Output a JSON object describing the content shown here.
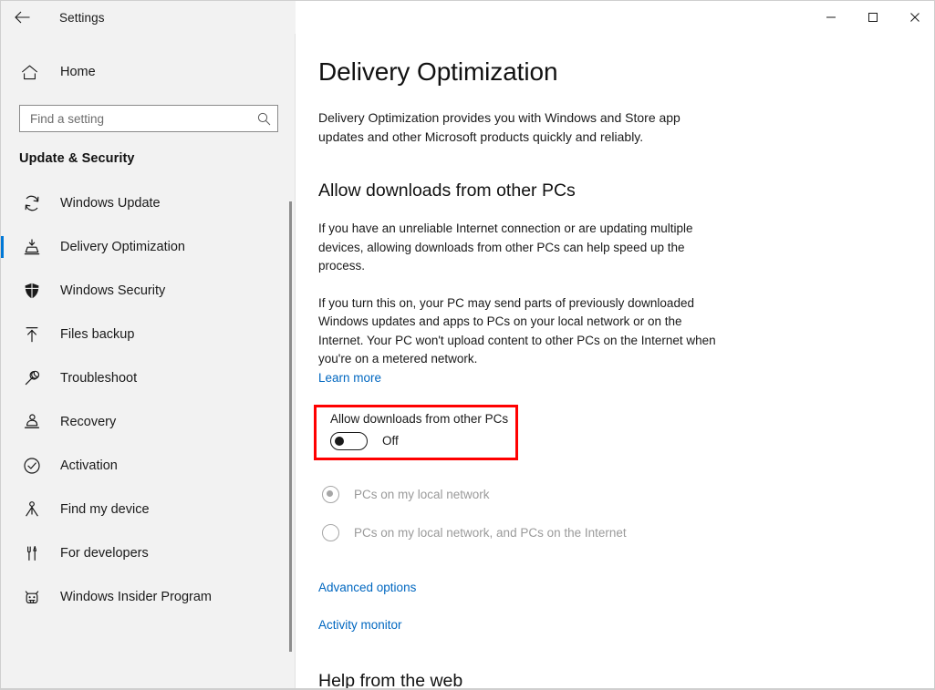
{
  "window": {
    "titlebar": {
      "back_icon": "back-arrow-icon",
      "title": "Settings",
      "minimize_label": "Minimize",
      "maximize_label": "Maximize",
      "close_label": "Close"
    },
    "accent_color": "#0078d7",
    "highlight_color": "#ff0000",
    "link_color": "#0067c0"
  },
  "sidebar": {
    "home": {
      "icon": "home-icon",
      "label": "Home"
    },
    "search": {
      "icon": "search-icon",
      "placeholder": "Find a setting",
      "value": ""
    },
    "category": "Update & Security",
    "items": [
      {
        "icon": "sync-refresh-icon",
        "label": "Windows Update",
        "selected": false
      },
      {
        "icon": "delivery-box-icon",
        "label": "Delivery Optimization",
        "selected": true
      },
      {
        "icon": "shield-icon",
        "label": "Windows Security",
        "selected": false
      },
      {
        "icon": "upload-arrow-icon",
        "label": "Files backup",
        "selected": false
      },
      {
        "icon": "wrench-icon",
        "label": "Troubleshoot",
        "selected": false
      },
      {
        "icon": "recovery-pc-icon",
        "label": "Recovery",
        "selected": false
      },
      {
        "icon": "check-circle-icon",
        "label": "Activation",
        "selected": false
      },
      {
        "icon": "person-pin-icon",
        "label": "Find my device",
        "selected": false
      },
      {
        "icon": "developer-tools-icon",
        "label": "For developers",
        "selected": false
      },
      {
        "icon": "insider-bug-icon",
        "label": "Windows Insider Program",
        "selected": false
      }
    ]
  },
  "main": {
    "page_title": "Delivery Optimization",
    "intro": "Delivery Optimization provides you with Windows and Store app updates and other Microsoft products quickly and reliably.",
    "section_heading": "Allow downloads from other PCs",
    "paragraph_1": "If you have an unreliable Internet connection or are updating multiple devices, allowing downloads from other PCs can help speed up the process.",
    "paragraph_2": "If you turn this on, your PC may send parts of previously downloaded Windows updates and apps to PCs on your local network or on the Internet. Your PC won't upload content to other PCs on the Internet when you're on a metered network.",
    "learn_more": "Learn more",
    "toggle": {
      "label": "Allow downloads from other PCs",
      "state": "Off",
      "checked": false
    },
    "radios": [
      {
        "label": "PCs on my local network",
        "checked": true,
        "disabled": true
      },
      {
        "label": "PCs on my local network, and PCs on the Internet",
        "checked": false,
        "disabled": true
      }
    ],
    "advanced_options": "Advanced options",
    "activity_monitor": "Activity monitor",
    "help_heading": "Help from the web"
  }
}
